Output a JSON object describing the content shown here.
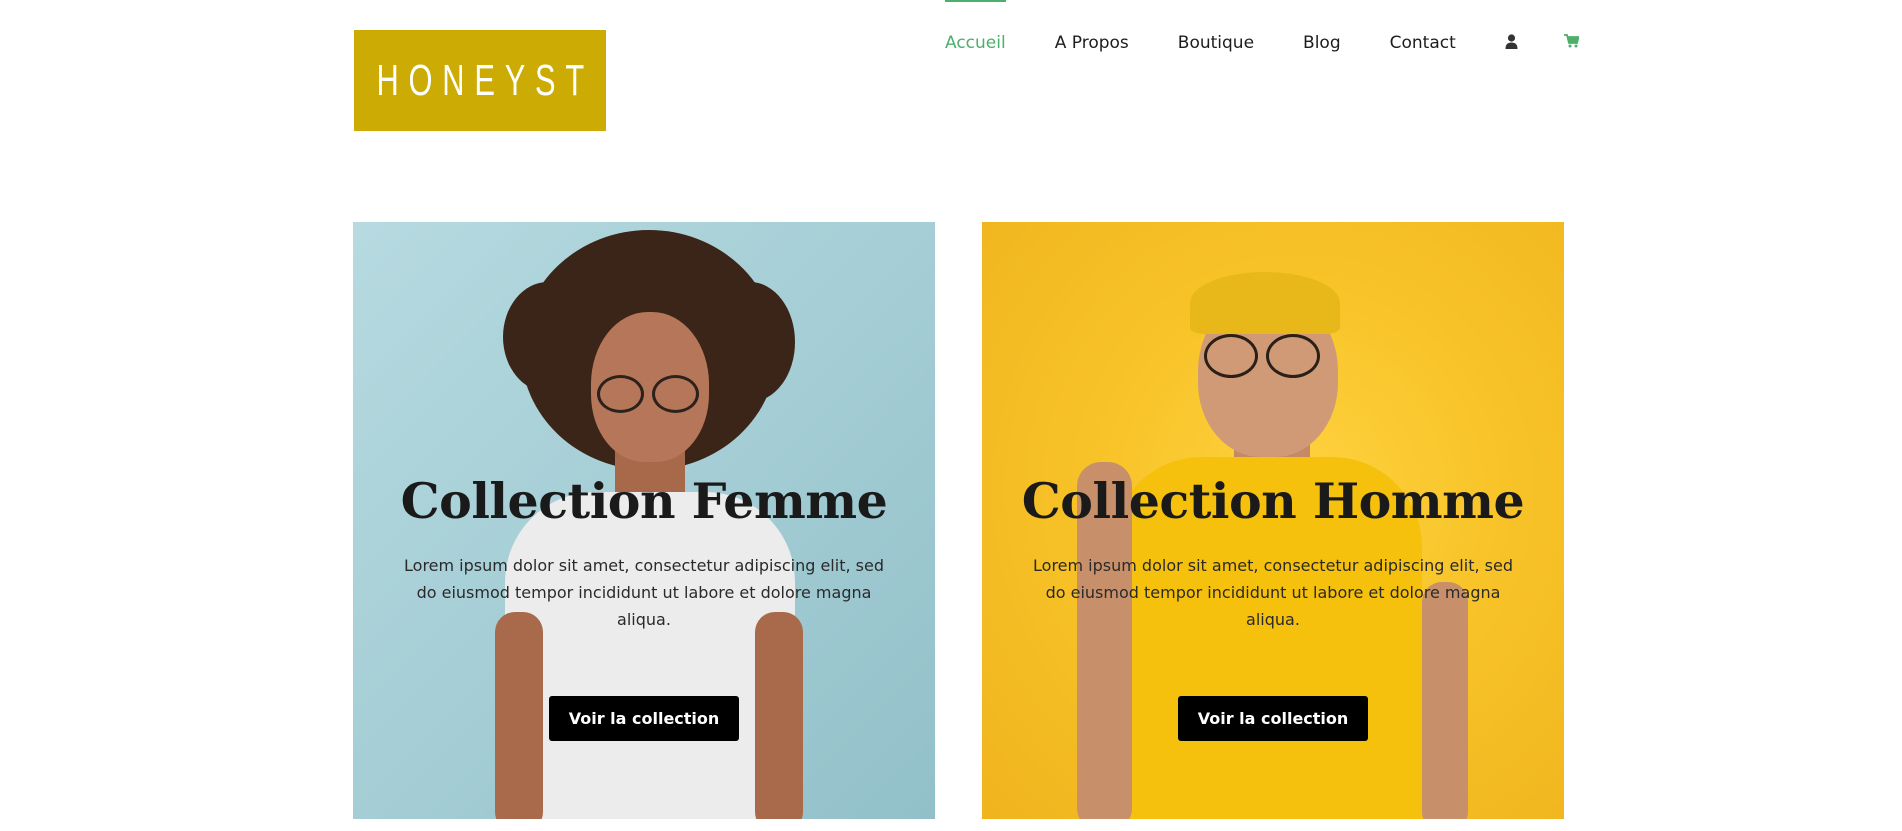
{
  "brand": {
    "logo_text": "HONEYST",
    "logo_color": "#ccac04"
  },
  "nav": {
    "items": [
      {
        "label": "Accueil",
        "active": true
      },
      {
        "label": "A Propos",
        "active": false
      },
      {
        "label": "Boutique",
        "active": false
      },
      {
        "label": "Blog",
        "active": false
      },
      {
        "label": "Contact",
        "active": false
      }
    ],
    "icons": [
      "user-icon",
      "cart-icon"
    ],
    "accent_color": "#4caf6b"
  },
  "collections": [
    {
      "title": "Collection Femme",
      "description": "Lorem ipsum dolor sit amet, consectetur adipiscing elit, sed do eiusmod tempor incididunt ut labore et dolore magna aliqua.",
      "button_label": "Voir la collection",
      "background_color": "#a9d1d8"
    },
    {
      "title": "Collection Homme",
      "description": "Lorem ipsum dolor sit amet, consectetur adipiscing elit, sed do eiusmod tempor incididunt ut labore et dolore magna aliqua.",
      "button_label": "Voir la collection",
      "background_color": "#f7c328"
    }
  ]
}
